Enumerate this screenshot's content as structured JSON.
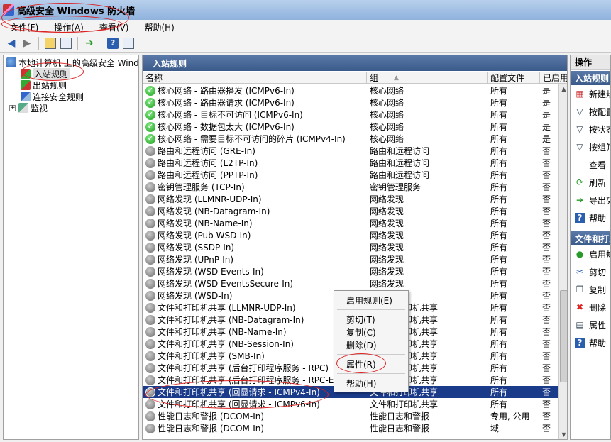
{
  "window": {
    "title": "高级安全 Windows 防火墙"
  },
  "menu": [
    "文件(F)",
    "操作(A)",
    "查看(V)",
    "帮助(H)"
  ],
  "tree": {
    "root": "本地计算机 上的高级安全 Windows 防火墙",
    "items": [
      "入站规则",
      "出站规则",
      "连接安全规则",
      "监视"
    ]
  },
  "center": {
    "title": "入站规则",
    "columns": [
      "名称",
      "组",
      "配置文件",
      "已启用"
    ],
    "rows": [
      [
        "核心网络 - 路由器播发 (ICMPv6-In)",
        "核心网络",
        "所有",
        "是",
        "on"
      ],
      [
        "核心网络 - 路由器请求 (ICMPv6-In)",
        "核心网络",
        "所有",
        "是",
        "on"
      ],
      [
        "核心网络 - 目标不可访问 (ICMPv6-In)",
        "核心网络",
        "所有",
        "是",
        "on"
      ],
      [
        "核心网络 - 数据包太大 (ICMPv6-In)",
        "核心网络",
        "所有",
        "是",
        "on"
      ],
      [
        "核心网络 - 需要目标不可访问的碎片 (ICMPv4-In)",
        "核心网络",
        "所有",
        "是",
        "on"
      ],
      [
        "路由和远程访问 (GRE-In)",
        "路由和远程访问",
        "所有",
        "否",
        "off"
      ],
      [
        "路由和远程访问 (L2TP-In)",
        "路由和远程访问",
        "所有",
        "否",
        "off"
      ],
      [
        "路由和远程访问 (PPTP-In)",
        "路由和远程访问",
        "所有",
        "否",
        "off"
      ],
      [
        "密钥管理服务 (TCP-In)",
        "密钥管理服务",
        "所有",
        "否",
        "off"
      ],
      [
        "网络发现 (LLMNR-UDP-In)",
        "网络发现",
        "所有",
        "否",
        "off"
      ],
      [
        "网络发现 (NB-Datagram-In)",
        "网络发现",
        "所有",
        "否",
        "off"
      ],
      [
        "网络发现 (NB-Name-In)",
        "网络发现",
        "所有",
        "否",
        "off"
      ],
      [
        "网络发现 (Pub-WSD-In)",
        "网络发现",
        "所有",
        "否",
        "off"
      ],
      [
        "网络发现 (SSDP-In)",
        "网络发现",
        "所有",
        "否",
        "off"
      ],
      [
        "网络发现 (UPnP-In)",
        "网络发现",
        "所有",
        "否",
        "off"
      ],
      [
        "网络发现 (WSD Events-In)",
        "网络发现",
        "所有",
        "否",
        "off"
      ],
      [
        "网络发现 (WSD EventsSecure-In)",
        "网络发现",
        "所有",
        "否",
        "off"
      ],
      [
        "网络发现 (WSD-In)",
        "网络发现",
        "所有",
        "否",
        "off"
      ],
      [
        "文件和打印机共享 (LLMNR-UDP-In)",
        "文件和打印机共享",
        "所有",
        "否",
        "off"
      ],
      [
        "文件和打印机共享 (NB-Datagram-In)",
        "文件和打印机共享",
        "所有",
        "否",
        "off"
      ],
      [
        "文件和打印机共享 (NB-Name-In)",
        "文件和打印机共享",
        "所有",
        "否",
        "off"
      ],
      [
        "文件和打印机共享 (NB-Session-In)",
        "文件和打印机共享",
        "所有",
        "否",
        "off"
      ],
      [
        "文件和打印机共享 (SMB-In)",
        "文件和打印机共享",
        "所有",
        "否",
        "off"
      ],
      [
        "文件和打印机共享 (后台打印程序服务 - RPC)",
        "文件和打印机共享",
        "所有",
        "否",
        "off"
      ],
      [
        "文件和打印机共享 (后台打印程序服务 - RPC-EPMAP)",
        "文件和打印机共享",
        "所有",
        "否",
        "off"
      ],
      [
        "文件和打印机共享 (回显请求 - ICMPv4-In)",
        "文件和打印机共享",
        "所有",
        "否",
        "off"
      ],
      [
        "文件和打印机共享 (回显请求 - ICMPv6-In)",
        "文件和打印机共享",
        "所有",
        "否",
        "off"
      ],
      [
        "性能日志和警报 (DCOM-In)",
        "性能日志和警报",
        "专用, 公用",
        "否",
        "off"
      ],
      [
        "性能日志和警报 (DCOM-In)",
        "性能日志和警报",
        "域",
        "否",
        "off"
      ]
    ],
    "selected_row": 25
  },
  "actions": {
    "title": "操作",
    "section1": "入站规则",
    "items1": [
      "新建规则...",
      "按配置文件筛选",
      "按状态筛选",
      "按组筛选",
      "查看",
      "刷新",
      "导出列表...",
      "帮助"
    ],
    "section2": "文件和打印机共享",
    "items2": [
      "启用规则",
      "剪切",
      "复制",
      "删除",
      "属性",
      "帮助"
    ]
  },
  "context_menu": [
    "启用规则(E)",
    "剪切(T)",
    "复制(C)",
    "删除(D)",
    "属性(R)",
    "帮助(H)"
  ],
  "colors": {
    "header_blue": "#3a5a8a",
    "selected_row": "#1a3a8a",
    "annotation": "#dd2222"
  }
}
